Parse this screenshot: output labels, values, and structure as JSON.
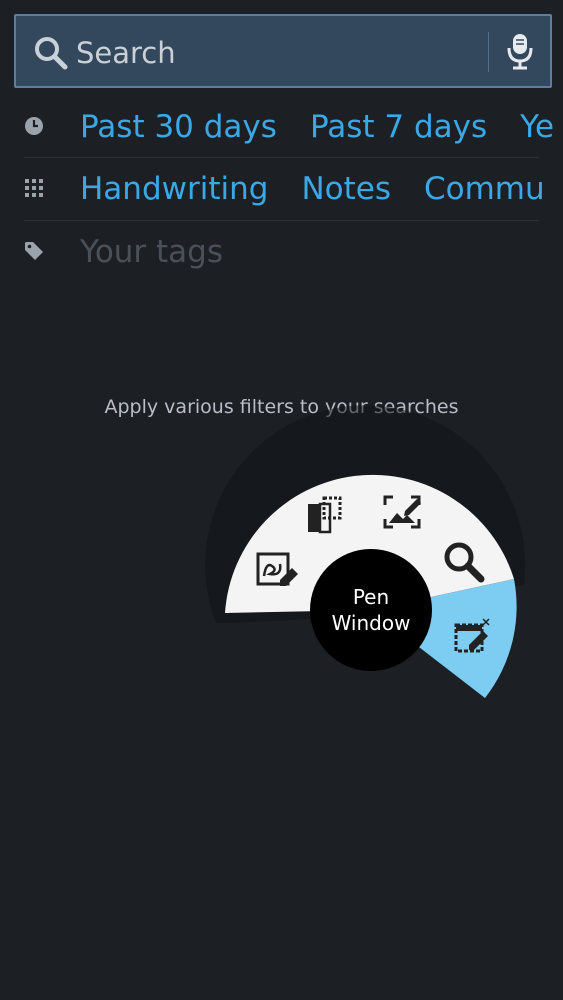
{
  "search": {
    "placeholder": "Search"
  },
  "time_filters": {
    "icon": "clock-icon",
    "items": [
      "Past 30 days",
      "Past 7 days",
      "Ye"
    ]
  },
  "category_filters": {
    "icon": "grid-icon",
    "items": [
      "Handwriting",
      "Notes",
      "Commu"
    ]
  },
  "tags": {
    "icon": "tag-icon",
    "placeholder": "Your tags"
  },
  "hint": "Apply various filters to your searches",
  "pen_menu": {
    "center_line1": "Pen",
    "center_line2": "Window",
    "items": [
      "image-clip-icon",
      "screen-write-icon",
      "action-memo-icon",
      "s-finder-icon",
      "pen-window-icon"
    ],
    "highlight_color": "#7dcdf2"
  }
}
